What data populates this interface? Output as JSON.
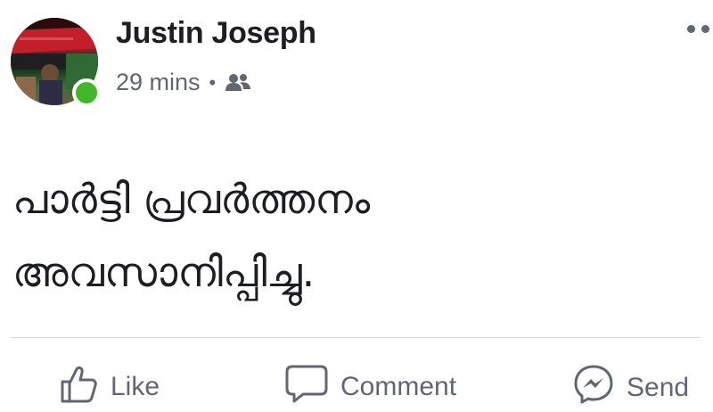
{
  "post": {
    "author": "Justin Joseph",
    "time": "29 mins",
    "separator": "•",
    "audience_icon": "friends-icon",
    "online": true,
    "text_lines": [
      "പാർട്ടി പ്രവർത്തനം",
      "അവസാനിപ്പിച്ചു."
    ]
  },
  "actions": {
    "like_label": "Like",
    "comment_label": "Comment",
    "send_label": "Send"
  },
  "colors": {
    "online": "#42b72a",
    "secondary_text": "#606770",
    "primary_text": "#1c1e21"
  }
}
